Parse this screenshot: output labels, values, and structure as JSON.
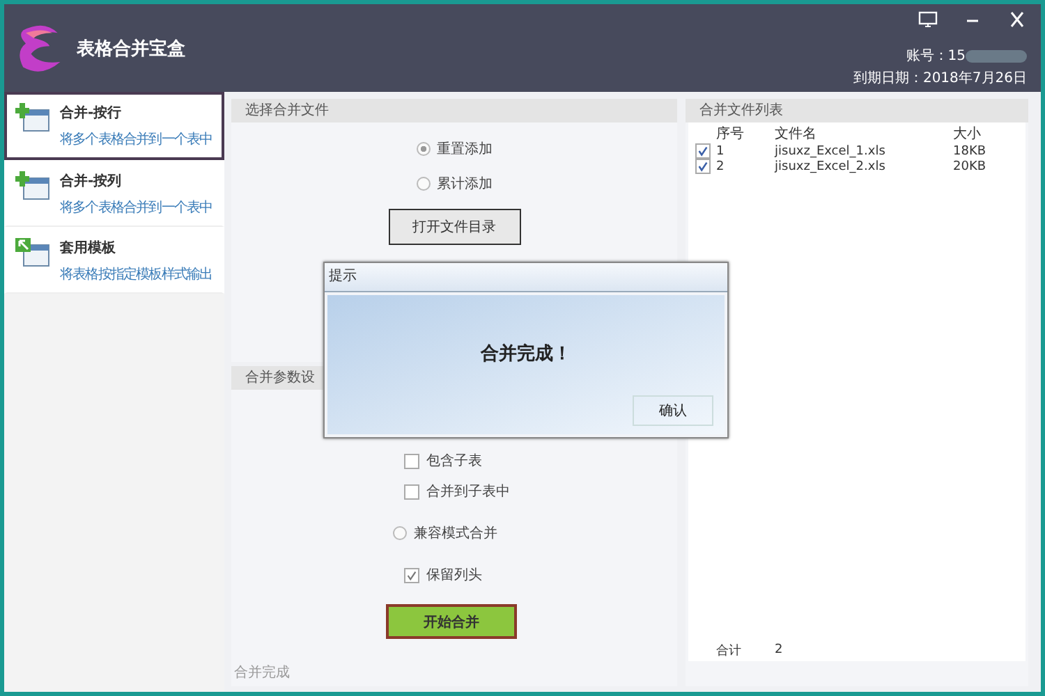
{
  "window": {
    "title": "表格合并宝盒",
    "account": "账号：15",
    "expiry": "到期日期：2018年7月26日"
  },
  "sidebar": {
    "items": [
      {
        "kind": "plus",
        "title": "合并-按行",
        "subtitle": "将多个表格合并到一个表中",
        "selected": true
      },
      {
        "kind": "plus",
        "title": "合并-按列",
        "subtitle": "将多个表格合并到一个表中",
        "selected": false
      },
      {
        "kind": "template",
        "title": "套用模板",
        "subtitle": "将表格按指定模板样式输出",
        "selected": false
      }
    ]
  },
  "file_section": {
    "title": "选择合并文件",
    "options": [
      {
        "label": "重置添加",
        "selected": true
      },
      {
        "label": "累计添加",
        "selected": false
      }
    ],
    "open_button": "打开文件目录"
  },
  "params_section": {
    "title": "合并参数设",
    "controls": [
      {
        "kind": "checkbox",
        "label": "包含子表",
        "checked": false
      },
      {
        "kind": "checkbox",
        "label": "合并到子表中",
        "checked": false
      },
      {
        "kind": "radio",
        "label": "兼容模式合并",
        "selected": false
      },
      {
        "kind": "checkbox",
        "label": "保留列头",
        "checked": true
      }
    ],
    "start_button": "开始合并"
  },
  "status": "合并完成",
  "file_list": {
    "title": "合并文件列表",
    "columns": [
      "序号",
      "文件名",
      "大小"
    ],
    "rows": [
      {
        "checked": true,
        "index": "1",
        "name": "jisuxz_Excel_1.xls",
        "size": "18KB"
      },
      {
        "checked": true,
        "index": "2",
        "name": "jisuxz_Excel_2.xls",
        "size": "20KB"
      }
    ],
    "total_label": "合计",
    "total": "2"
  },
  "dialog": {
    "title": "提示",
    "message": "合并完成！",
    "ok_button": "确认"
  }
}
